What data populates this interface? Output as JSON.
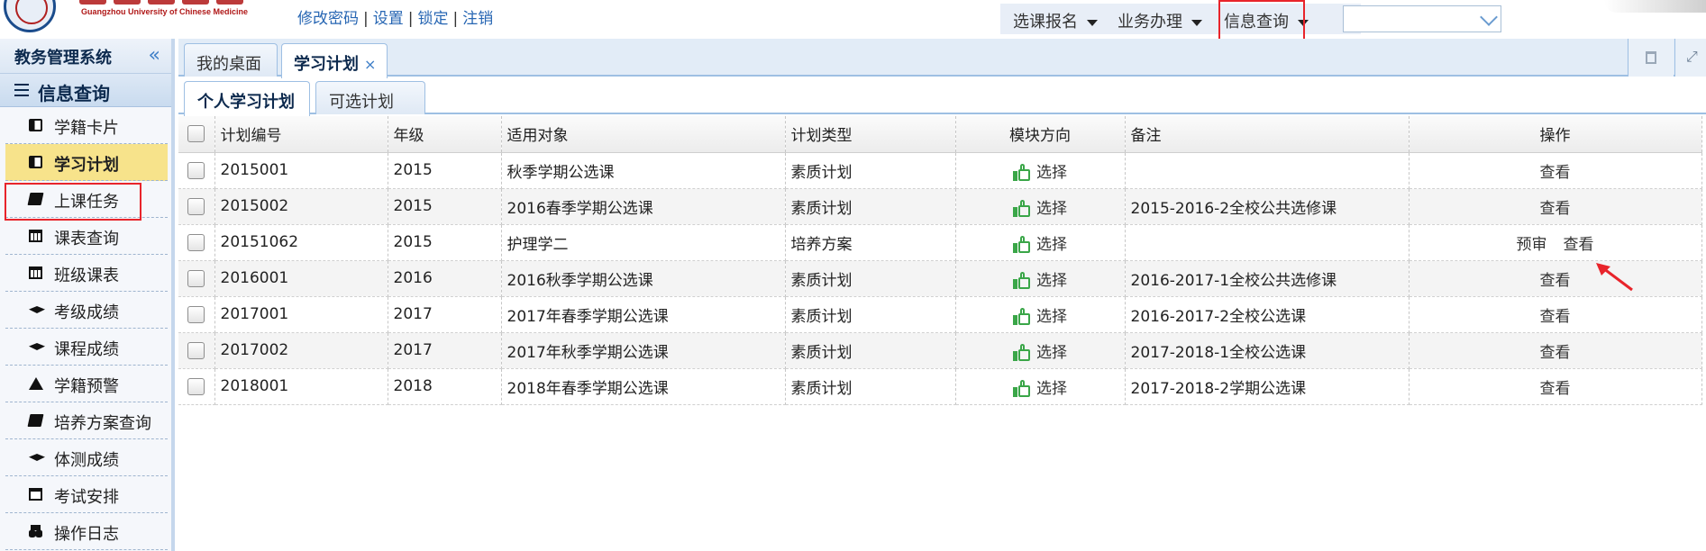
{
  "header": {
    "logo_subtitle": "Guangzhou University of Chinese Medicine",
    "logo_title": "广州中医药大学",
    "links": [
      "修改密码",
      "设置",
      "锁定",
      "注销"
    ],
    "menus": [
      "选课报名",
      "业务办理",
      "信息查询"
    ],
    "select_value": ""
  },
  "sidebar": {
    "title": "教务管理系统",
    "section": "信息查询",
    "items": [
      {
        "label": "学籍卡片",
        "icon": "id-card-icon"
      },
      {
        "label": "学习计划",
        "icon": "newspaper-icon",
        "active": true
      },
      {
        "label": "上课任务",
        "icon": "book-icon"
      },
      {
        "label": "课表查询",
        "icon": "calendar-icon"
      },
      {
        "label": "班级课表",
        "icon": "calendar-icon"
      },
      {
        "label": "考级成绩",
        "icon": "graduation-cap-icon"
      },
      {
        "label": "课程成绩",
        "icon": "graduation-cap-icon"
      },
      {
        "label": "学籍预警",
        "icon": "warning-icon"
      },
      {
        "label": "培养方案查询",
        "icon": "book-icon"
      },
      {
        "label": "体测成绩",
        "icon": "graduation-cap-icon"
      },
      {
        "label": "考试安排",
        "icon": "calendar-empty-icon"
      },
      {
        "label": "操作日志",
        "icon": "binoculars-icon"
      }
    ]
  },
  "tabs": {
    "desktop": "我的桌面",
    "plan": "学习计划",
    "close": "×"
  },
  "subtabs": {
    "personal": "个人学习计划",
    "optional": "可选计划"
  },
  "table": {
    "columns": [
      "计划编号",
      "年级",
      "适用对象",
      "计划类型",
      "模块方向",
      "备注",
      "操作"
    ],
    "select_label": "选择",
    "view_label": "查看",
    "review_label": "预审",
    "rows": [
      {
        "id": "2015001",
        "grade": "2015",
        "target": "秋季学期公选课",
        "type": "素质计划",
        "note": "",
        "review": false
      },
      {
        "id": "2015002",
        "grade": "2015",
        "target": "2016春季学期公选课",
        "type": "素质计划",
        "note": "2015-2016-2全校公共选修课",
        "review": false
      },
      {
        "id": "20151062",
        "grade": "2015",
        "target": "护理学二",
        "type": "培养方案",
        "note": "",
        "review": true
      },
      {
        "id": "2016001",
        "grade": "2016",
        "target": "2016秋季学期公选课",
        "type": "素质计划",
        "note": "2016-2017-1全校公共选修课",
        "review": false
      },
      {
        "id": "2017001",
        "grade": "2017",
        "target": "2017年春季学期公选课",
        "type": "素质计划",
        "note": "2016-2017-2全校公选课",
        "review": false
      },
      {
        "id": "2017002",
        "grade": "2017",
        "target": "2017年秋季学期公选课",
        "type": "素质计划",
        "note": "2017-2018-1全校公选课",
        "review": false
      },
      {
        "id": "2018001",
        "grade": "2018",
        "target": "2018年春季学期公选课",
        "type": "素质计划",
        "note": "2017-2018-2学期公选课",
        "review": false
      }
    ]
  },
  "colors": {
    "highlight_box": "#e8242b",
    "active_item_bg": "#f7e38b",
    "thumb_icon": "#3aa648",
    "link_blue": "#2766b3"
  }
}
